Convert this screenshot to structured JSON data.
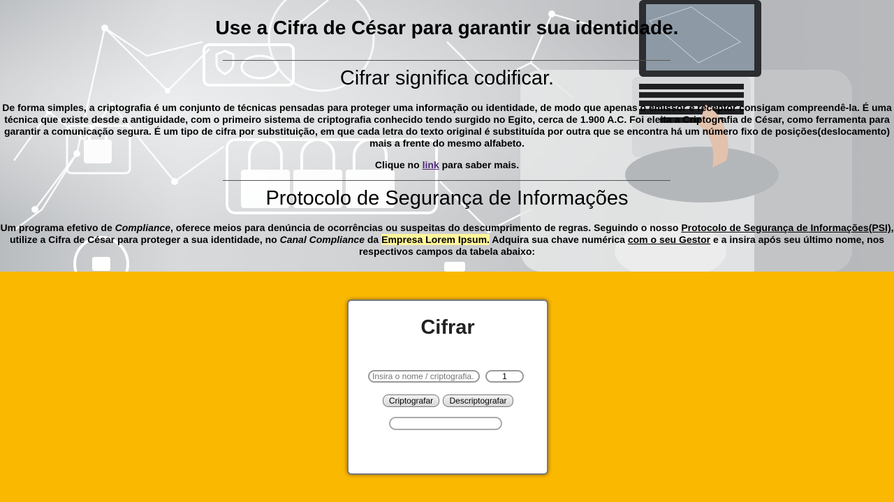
{
  "hero": {
    "title": "Use a Cifra de César para garantir sua identidade.",
    "subtitle1": "Cifrar significa codificar.",
    "paragraph1": "De forma simples, a criptografia é um conjunto de técnicas pensadas para proteger uma informação ou identidade, de modo que apenas o emissor e receptor consigam compreendê-la. É uma técnica que existe desde a antiguidade, com o primeiro sistema de criptografia conhecido tendo surgido no Egito, cerca de 1.900 A.C. Foi eleita a Criptografia de César, como ferramenta para garantir a comunicação segura. É um tipo de cifra por substituição, em que cada letra do texto original é substituída por outra que se encontra há um número fixo de posições(deslocamento) mais a frente do mesmo alfabeto.",
    "click_prefix": "Clique no ",
    "click_link": "link",
    "click_suffix": " para saber mais.",
    "subtitle2": "Protocolo de Segurança de Informações",
    "p2_a": "Um programa efetivo de ",
    "p2_compliance": "Compliance",
    "p2_b": ", oferece meios para denúncia de ocorrências ou suspeitas do descumprimento de regras. Seguindo o nosso ",
    "p2_psi_link": "Protocolo de Segurança de Informações(PSI)",
    "p2_c": ", utilize a Cifra de César para proteger a sua identidade, no ",
    "p2_canal": "Canal Compliance",
    "p2_d": " da ",
    "p2_empresa": "Empresa Lorem Ipsum.",
    "p2_e": " Adquira sua chave numérica ",
    "p2_gestor_link": "com o seu Gestor",
    "p2_f": " e a insira após seu último nome, nos respectivos campos da tabela abaixo:"
  },
  "card": {
    "title": "Cifrar",
    "name_placeholder": "Insira o nome / criptografia.",
    "key_value": "1",
    "encrypt_label": "Criptografar",
    "decrypt_label": "Descriptografar",
    "output_value": ""
  },
  "colors": {
    "page_background": "#fbb800",
    "highlight": "#fff59a"
  }
}
